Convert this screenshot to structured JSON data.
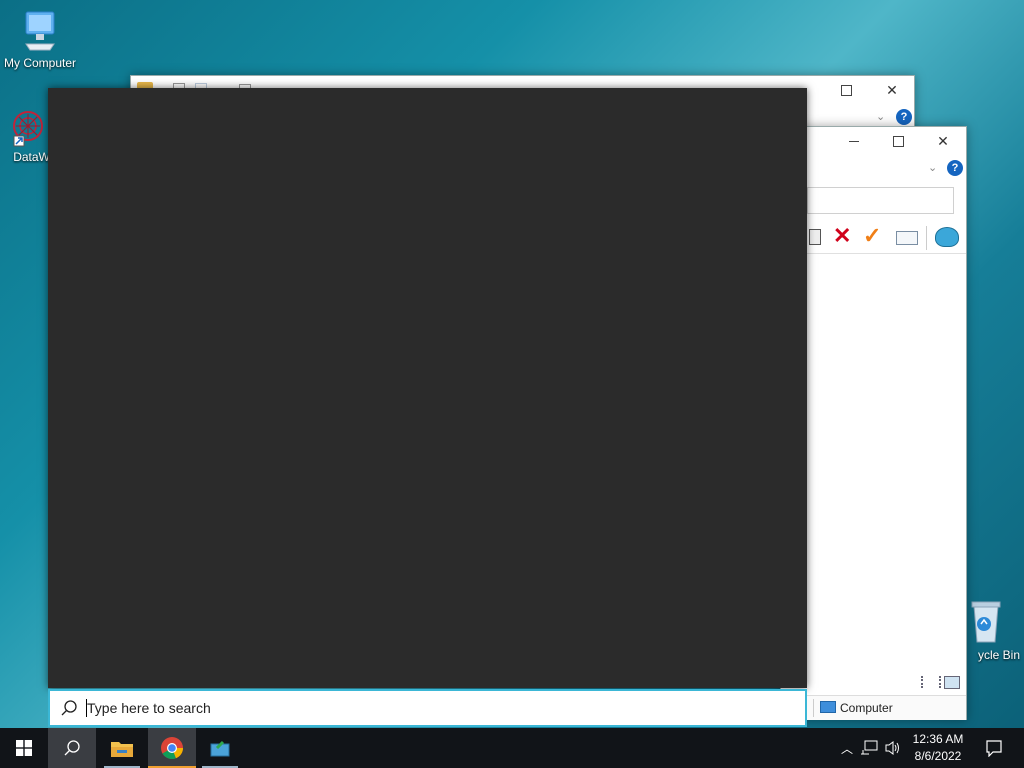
{
  "desktop": {
    "icons": [
      {
        "label": "My Computer"
      },
      {
        "label": "DataWag"
      },
      {
        "label": "ycle Bin"
      }
    ]
  },
  "window_front": {
    "status": {
      "computer_label": "Computer"
    }
  },
  "search": {
    "placeholder": "Type here to search"
  },
  "clock": {
    "time": "12:36 AM",
    "date": "8/6/2022"
  },
  "colors": {
    "start_panel_bg": "#2b2b2b",
    "search_border": "#3bb7d6",
    "taskbar_bg": "#111418",
    "accent_blue": "#1565c0"
  }
}
